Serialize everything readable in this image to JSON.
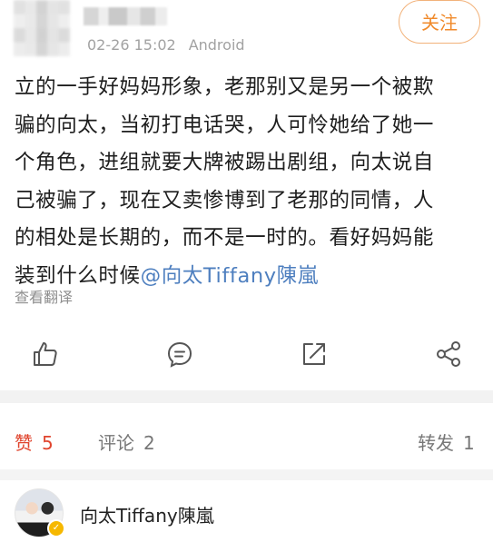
{
  "post": {
    "meta_time": "02-26 15:02",
    "meta_source": "Android",
    "follow_label": "关注",
    "body_lines": [
      "立的一手好妈妈形象，老那别又是另一个被欺",
      "骗的向太，当初打电话哭，人可怜她给了她一",
      "个角色，进组就要大牌被踢出剧组，向太说自",
      "己被骗了，现在又卖惨博到了老那的同情，人",
      "的相处是长期的，而不是一时的。看好妈妈能"
    ],
    "body_last_line_prefix": "装到什么时候",
    "mention": "@向太Tiffany陳嵐",
    "translate_label": "查看翻译"
  },
  "actions": {
    "icons": [
      "thumb-up-icon",
      "comment-icon",
      "repost-icon",
      "share-icon"
    ]
  },
  "stats": {
    "likes_label": "赞",
    "likes_count": "5",
    "comments_label": "评论",
    "comments_count": "2",
    "reposts_label": "转发",
    "reposts_count": "1"
  },
  "liker": {
    "name": "向太Tiffany陳嵐"
  },
  "colors": {
    "accent_orange": "#f08a2b",
    "like_red": "#e0442d",
    "mention_blue": "#4e7fbf"
  }
}
